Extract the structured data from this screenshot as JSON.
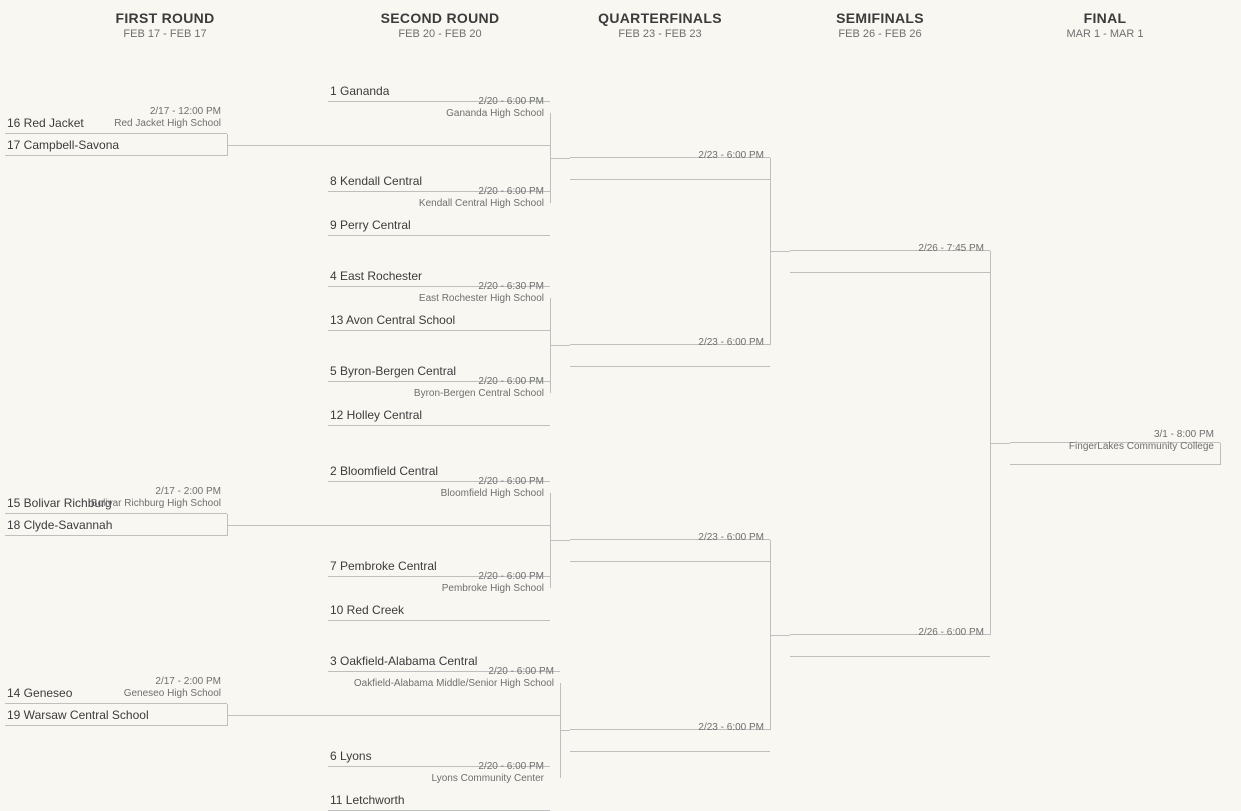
{
  "rounds": {
    "first": {
      "title": "FIRST ROUND",
      "dates": "FEB 17 - FEB 17"
    },
    "second": {
      "title": "SECOND ROUND",
      "dates": "FEB 20 - FEB 20"
    },
    "quarter": {
      "title": "QUARTERFINALS",
      "dates": "FEB 23 - FEB 23"
    },
    "semi": {
      "title": "SEMIFINALS",
      "dates": "FEB 26 - FEB 26"
    },
    "final": {
      "title": "FINAL",
      "dates": "MAR 1 - MAR 1"
    }
  },
  "r1": {
    "m1": {
      "top": "16 Red Jacket",
      "bot": "17 Campbell-Savona",
      "time": "2/17 - 12:00 PM",
      "loc": "Red Jacket High School"
    },
    "m2": {
      "top": "15 Bolivar Richburg",
      "bot": "18 Clyde-Savannah",
      "time": "2/17 - 2:00 PM",
      "loc": "Bolivar Richburg High School"
    },
    "m3": {
      "top": "14 Geneseo",
      "bot": "19 Warsaw Central School",
      "time": "2/17 - 2:00 PM",
      "loc": "Geneseo High School"
    }
  },
  "r2": {
    "m1": {
      "top": "1 Gananda",
      "bot": "",
      "time": "2/20 - 6:00 PM",
      "loc": "Gananda High School"
    },
    "m2": {
      "top": "8 Kendall Central",
      "bot": "9 Perry Central",
      "time": "2/20 - 6:00 PM",
      "loc": "Kendall Central High School"
    },
    "m3": {
      "top": "4 East Rochester",
      "bot": "13 Avon Central School",
      "time": "2/20 - 6:30 PM",
      "loc": "East Rochester High School"
    },
    "m4": {
      "top": "5 Byron-Bergen Central",
      "bot": "12 Holley Central",
      "time": "2/20 - 6:00 PM",
      "loc": "Byron-Bergen Central School"
    },
    "m5": {
      "top": "2 Bloomfield Central",
      "bot": "",
      "time": "2/20 - 6:00 PM",
      "loc": "Bloomfield High School"
    },
    "m6": {
      "top": "7 Pembroke Central",
      "bot": "10 Red Creek",
      "time": "2/20 - 6:00 PM",
      "loc": "Pembroke High School"
    },
    "m7": {
      "top": "3 Oakfield-Alabama Central",
      "bot": "",
      "time": "2/20 - 6:00 PM",
      "loc": "Oakfield-Alabama Middle/Senior High School"
    },
    "m8": {
      "top": "6 Lyons",
      "bot": "11 Letchworth",
      "time": "2/20 - 6:00 PM",
      "loc": "Lyons Community Center"
    }
  },
  "qf": {
    "m1": {
      "time": "2/23 - 6:00 PM"
    },
    "m2": {
      "time": "2/23 - 6:00 PM"
    },
    "m3": {
      "time": "2/23 - 6:00 PM"
    },
    "m4": {
      "time": "2/23 - 6:00 PM"
    }
  },
  "sf": {
    "m1": {
      "time": "2/26 - 7:45 PM"
    },
    "m2": {
      "time": "2/26 - 6:00 PM"
    }
  },
  "final": {
    "time": "3/1 - 8:00 PM",
    "loc": "FingerLakes Community College"
  }
}
